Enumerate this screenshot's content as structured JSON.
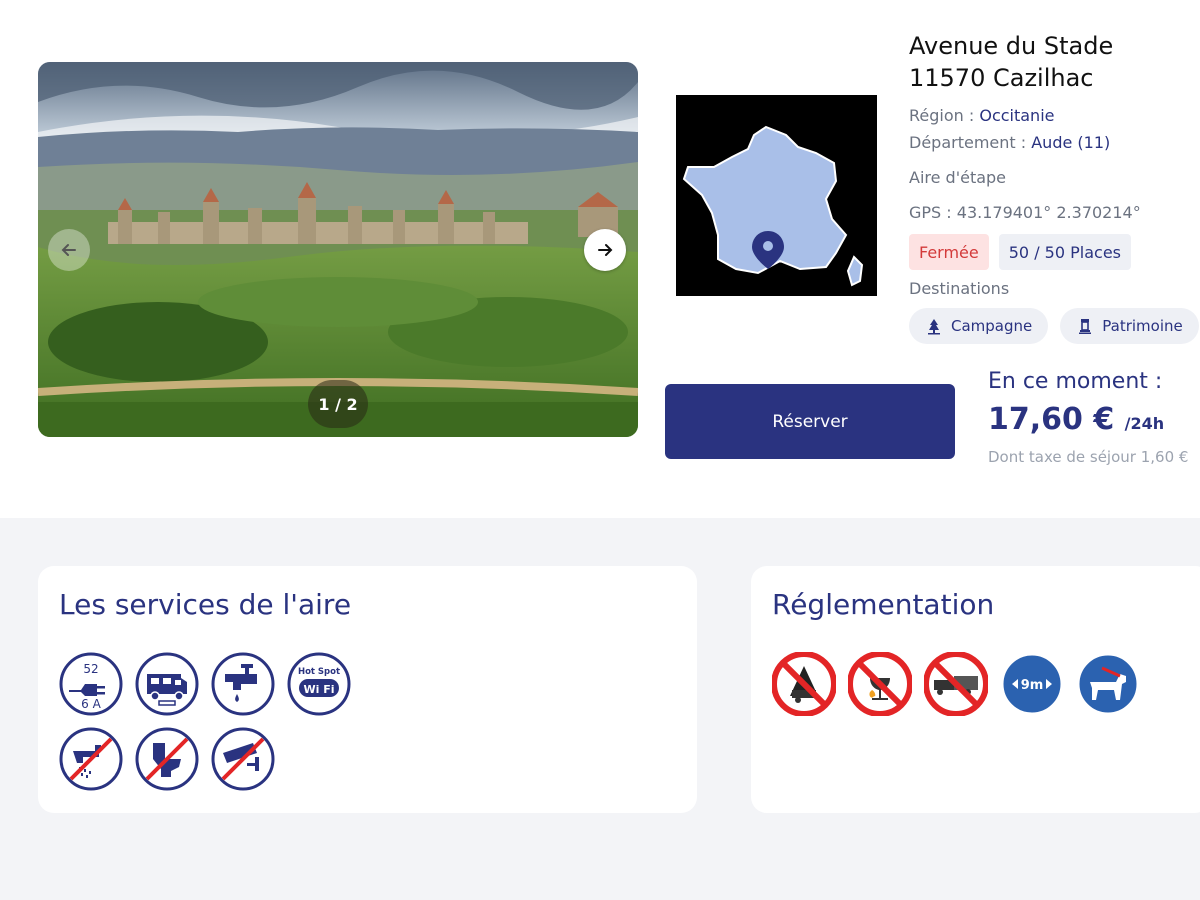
{
  "gallery": {
    "counter": "1 / 2",
    "prev_icon": "arrow-left-icon",
    "next_icon": "arrow-right-icon"
  },
  "address": {
    "line1": "Avenue du Stade",
    "line2": "11570 Cazilhac"
  },
  "details": {
    "region_label": "Région :",
    "region_value": "Occitanie",
    "department_label": "Département :",
    "department_value": "Aude (11)",
    "type": "Aire d'étape",
    "gps": "GPS : 43.179401° 2.370214°"
  },
  "status": {
    "closed_label": "Fermée",
    "places": "50 / 50 Places",
    "closed_color": "#d33a3a",
    "closed_bg": "#fde2e2"
  },
  "destinations": {
    "title": "Destinations",
    "items": [
      {
        "label": "Campagne",
        "icon": "countryside-icon"
      },
      {
        "label": "Patrimoine",
        "icon": "heritage-icon"
      }
    ]
  },
  "booking": {
    "button_label": "Réserver",
    "now_label": "En ce moment :",
    "price": "17,60 €",
    "period": "/24h",
    "tax_note": "Dont taxe de séjour 1,60 €"
  },
  "services": {
    "title": "Les services de l'aire",
    "electric_amps_top": "52",
    "electric_amps_bottom": "6 A",
    "wifi_top": "Hot Spot",
    "wifi_label": "Wi Fi",
    "icons": [
      "electricity-icon",
      "motorhome-parking-icon",
      "water-tap-icon",
      "wifi-hotspot-icon",
      "no-shower-icon",
      "no-toilet-icon",
      "no-video-surveillance-icon"
    ]
  },
  "rules": {
    "title": "Réglementation",
    "length_limit": "9m",
    "icons": [
      "no-camping-icon",
      "no-barbecue-icon",
      "no-caravan-icon",
      "max-length-icon",
      "dogs-on-leash-icon"
    ]
  },
  "colors": {
    "brand": "#2a3380",
    "background_section": "#f3f4f7",
    "prohibition_red": "#e32526",
    "info_blue": "#2b62b0"
  }
}
